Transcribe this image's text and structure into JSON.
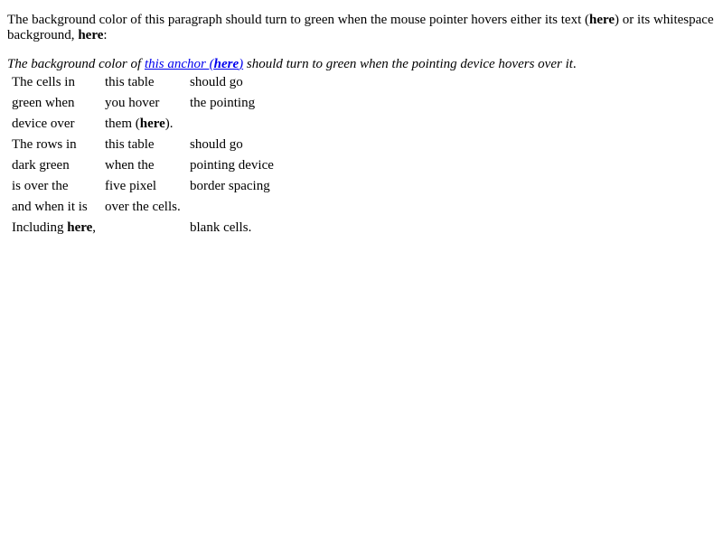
{
  "paragraph": {
    "part1": "The background color of this paragraph should turn to green when the mouse pointer hovers either its text (",
    "here1": "here",
    "part2": ") or its whitespace background, ",
    "here2": "here",
    "part3": ":"
  },
  "italic_paragraph": {
    "before": "The background color of ",
    "anchor_text": "this anchor (",
    "anchor_here": "here",
    "anchor_close": ")",
    "after": " should turn to green when the pointing device hovers over it",
    "end": "."
  },
  "table": {
    "rows": [
      {
        "c1": "The cells in",
        "c2": "this table",
        "c3": "should go"
      },
      {
        "c1": "green when",
        "c2": "you hover",
        "c3": "the pointing"
      },
      {
        "c1": "device over",
        "c2_pre": "them (",
        "c2_bold": "here",
        "c2_post": ").",
        "c3": ""
      },
      {
        "c1": "The rows in",
        "c2": "this table",
        "c3": "should go"
      },
      {
        "c1": "dark green",
        "c2": "when the",
        "c3": "pointing device"
      },
      {
        "c1": "is over the",
        "c2": "five pixel",
        "c3": "border spacing"
      },
      {
        "c1": "and when it is",
        "c2": "over the cells.",
        "c3": ""
      },
      {
        "c1_pre": "Including ",
        "c1_bold": "here",
        "c1_post": ",",
        "c2": "",
        "c3": "blank cells."
      }
    ]
  }
}
